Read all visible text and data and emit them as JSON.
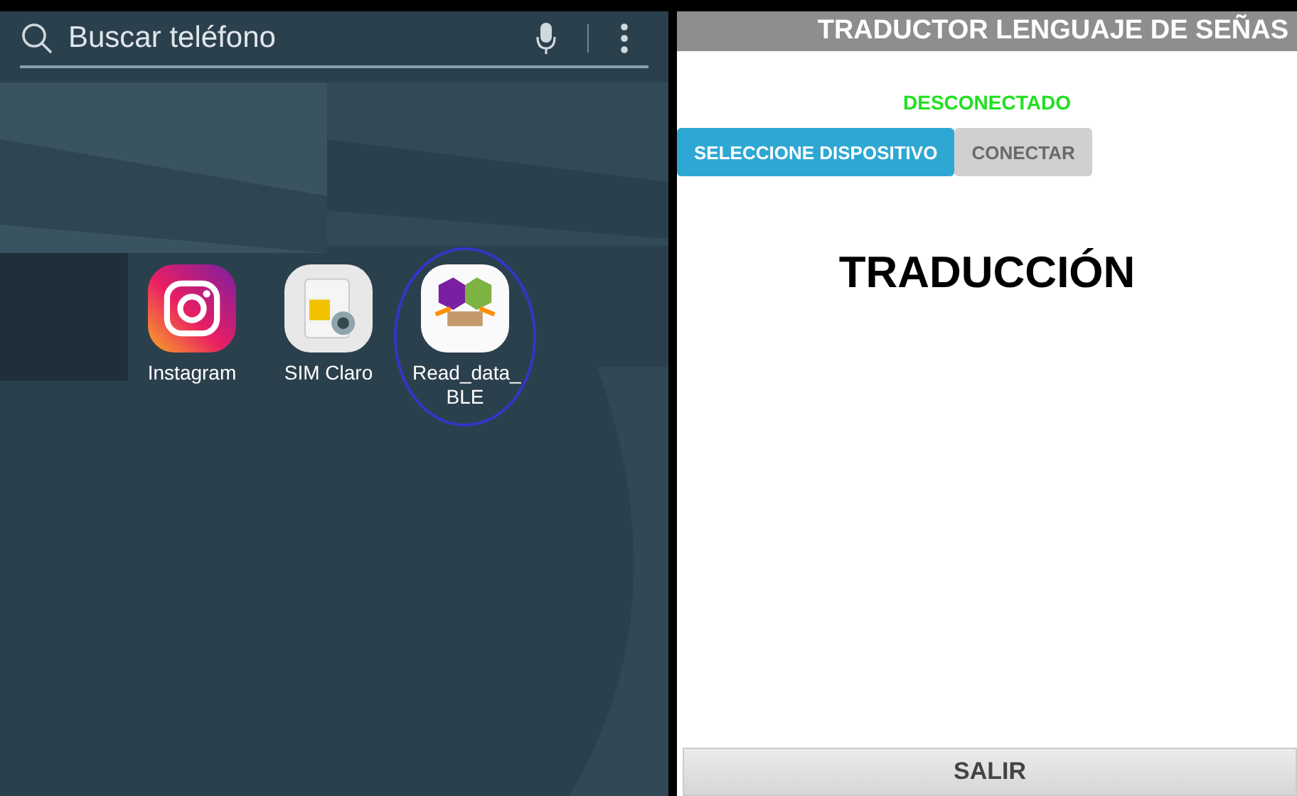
{
  "home_screen": {
    "search": {
      "placeholder": "Buscar teléfono"
    },
    "apps": [
      {
        "kind": "instagram",
        "label": "Instagram",
        "highlighted": false
      },
      {
        "kind": "sim",
        "label": "SIM Claro",
        "highlighted": false
      },
      {
        "kind": "ble",
        "label": "Read_data_ BLE",
        "highlighted": true
      }
    ]
  },
  "app_screen": {
    "title": "TRADUCTOR LENGUAJE DE SEÑAS",
    "status": "DESCONECTADO",
    "buttons": [
      {
        "label": "SELECCIONE DISPOSITIVO",
        "disabled": false
      },
      {
        "label": "CONECTAR",
        "disabled": true
      }
    ],
    "heading": "TRADUCCIÓN",
    "exit_button": "SALIR"
  }
}
